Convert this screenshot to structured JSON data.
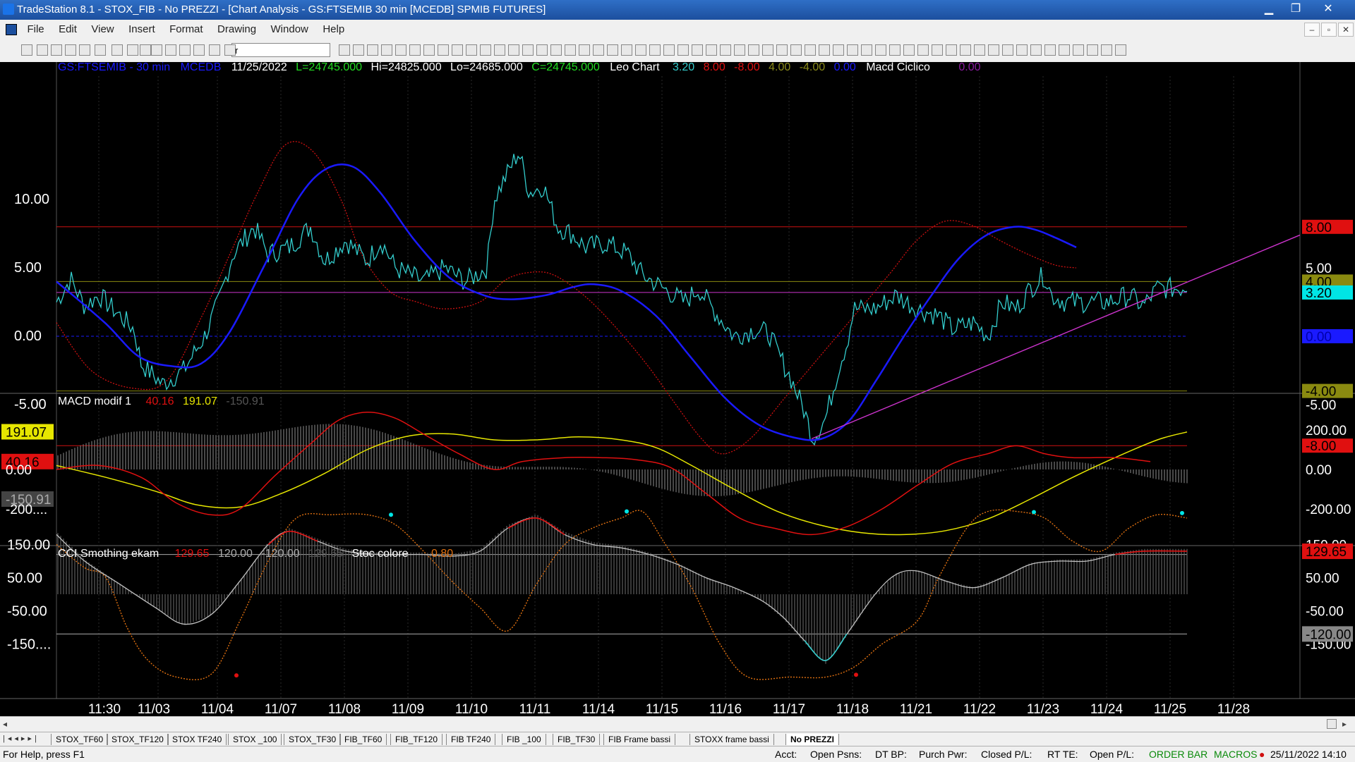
{
  "window": {
    "title": "TradeStation 8.1 - STOX_FIB - No PREZZI - [Chart Analysis - GS:FTSEMIB  30 min  [MCEDB] SPMIB FUTURES]",
    "minimize": "▁",
    "restore": "❐",
    "close": "✕"
  },
  "menu": {
    "items": [
      "File",
      "Edit",
      "View",
      "Insert",
      "Format",
      "Drawing",
      "Window",
      "Help"
    ],
    "mdi_min": "–",
    "mdi_restore": "▫",
    "mdi_close": "✕"
  },
  "toolbar": {
    "symbol_value": "r"
  },
  "chart": {
    "header": {
      "symbol": "GS:FTSEMIB - 30 min",
      "source": "MCEDB",
      "date": "11/25/2022",
      "last": "L=24745.000",
      "high": "Hi=24825.000",
      "low": "Lo=24685.000",
      "close": "C=24745.000",
      "indicator": "Leo Chart",
      "v1": "3.20",
      "v2": "8.00",
      "v3": "-8.00",
      "v4": "4.00",
      "v5": "-4.00",
      "v6": "0.00",
      "indicator2": "Macd Ciclico",
      "v7": "0.00"
    },
    "macd_header": {
      "name": "MACD modif 1",
      "v1": "40.16",
      "v2": "191.07",
      "v3": "-150.91"
    },
    "cci_header": {
      "name": "CCI Smothing ekam",
      "v1": "129.65",
      "v2": "120.00",
      "v3": "-120.00",
      "v4": "129.65",
      "name2": "Stoc colore",
      "v5": "0.80"
    },
    "colors": {
      "cyan": "#33cccc",
      "blue": "#1a1aff",
      "red": "#e01010",
      "yellow": "#e6e600",
      "magenta": "#cc33cc",
      "orange": "#e07010",
      "grey": "#9a9a9a"
    },
    "pane1_axis": [
      "10.00",
      "5.00",
      "0.00",
      "-5.00"
    ],
    "pane1_labels": [
      "8.00",
      "5.00",
      "4.00",
      "3.20",
      "0.00",
      "-4.00",
      "-5.00",
      "-8.00"
    ],
    "pane2_axis": [
      "200.00",
      "0.00",
      "-200.00"
    ],
    "pane2_left_labels": [
      "191.07",
      "40.16",
      "0.00",
      "-150.91",
      "-200...."
    ],
    "pane3_axis": [
      "150.00",
      "50.00",
      "-50.00",
      "-150.00"
    ],
    "pane3_labels": [
      "129.65",
      "-120.00",
      "-150.00"
    ],
    "pane3_left": [
      "150.00",
      "50.00",
      "-50.00",
      "-150...."
    ],
    "x_labels": [
      "11:30",
      "11/03",
      "11/04",
      "11/07",
      "11/08",
      "11/09",
      "11/10",
      "11/11",
      "11/14",
      "11/15",
      "11/16",
      "11/17",
      "11/18",
      "11/21",
      "11/22",
      "11/23",
      "11/24",
      "11/25",
      "11/28"
    ]
  },
  "tabs": [
    "STOX_TF60",
    "STOX_TF120",
    "STOX TF240",
    "STOX _100",
    "STOX_TF30",
    "FIB_TF60",
    "FIB_TF120",
    "FIB TF240",
    "FIB _100",
    "FIB_TF30",
    "FIB Frame bassi",
    "STOXX frame bassi",
    "No PREZZI"
  ],
  "status": {
    "help": "For Help, press F1",
    "acct": "Acct:",
    "open_psns": "Open Psns:",
    "dtbp": "DT BP:",
    "purch_pwr": "Purch Pwr:",
    "closed_pl": "Closed P/L:",
    "rt_te": "RT TE:",
    "open_pl": "Open P/L:",
    "order_bar": "ORDER BAR",
    "macros": "MACROS",
    "datetime": "25/11/2022 14:10"
  }
}
